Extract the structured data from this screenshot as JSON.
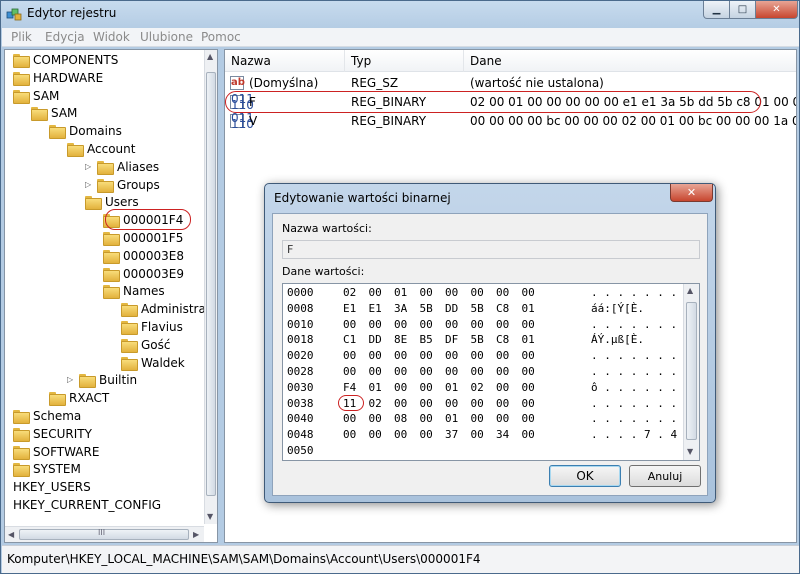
{
  "window": {
    "title": "Edytor rejestru"
  },
  "menu": [
    "Plik",
    "Edycja",
    "Widok",
    "Ulubione",
    "Pomoc"
  ],
  "tree": {
    "items": [
      {
        "label": "COMPONENTS",
        "level": 0,
        "expander": ""
      },
      {
        "label": "HARDWARE",
        "level": 0,
        "expander": ""
      },
      {
        "label": "SAM",
        "level": 0,
        "expander": ""
      },
      {
        "label": "SAM",
        "level": 1,
        "expander": ""
      },
      {
        "label": "Domains",
        "level": 2,
        "expander": ""
      },
      {
        "label": "Account",
        "level": 3,
        "expander": ""
      },
      {
        "label": "Aliases",
        "level": 4,
        "expander": "▷"
      },
      {
        "label": "Groups",
        "level": 4,
        "expander": "▷"
      },
      {
        "label": "Users",
        "level": 4,
        "expander": ""
      },
      {
        "label": "000001F4",
        "level": 5,
        "expander": ""
      },
      {
        "label": "000001F5",
        "level": 5,
        "expander": ""
      },
      {
        "label": "000003E8",
        "level": 5,
        "expander": ""
      },
      {
        "label": "000003E9",
        "level": 5,
        "expander": ""
      },
      {
        "label": "Names",
        "level": 5,
        "expander": ""
      },
      {
        "label": "Administra",
        "level": 6,
        "expander": ""
      },
      {
        "label": "Flavius",
        "level": 6,
        "expander": ""
      },
      {
        "label": "Gość",
        "level": 6,
        "expander": ""
      },
      {
        "label": "Waldek",
        "level": 6,
        "expander": ""
      },
      {
        "label": "Builtin",
        "level": 3,
        "expander": "▷"
      },
      {
        "label": "RXACT",
        "level": 2,
        "expander": ""
      },
      {
        "label": "Schema",
        "level": 0,
        "expander": ""
      },
      {
        "label": "SECURITY",
        "level": 0,
        "expander": ""
      },
      {
        "label": "SOFTWARE",
        "level": 0,
        "expander": ""
      },
      {
        "label": "SYSTEM",
        "level": 0,
        "expander": ""
      },
      {
        "label": "HKEY_USERS",
        "level": -1,
        "expander": ""
      },
      {
        "label": "HKEY_CURRENT_CONFIG",
        "level": -1,
        "expander": ""
      }
    ],
    "hscroll_grip": "III"
  },
  "list": {
    "columns": [
      "Nazwa",
      "Typ",
      "Dane"
    ],
    "rows": [
      {
        "icon": "ab",
        "name": "(Domyślna)",
        "type": "REG_SZ",
        "data": "(wartość nie ustalona)"
      },
      {
        "icon": "bin",
        "name": "F",
        "type": "REG_BINARY",
        "data": "02 00 01 00 00 00 00 00 e1 e1 3a 5b dd 5b c8 01 00 0..."
      },
      {
        "icon": "bin",
        "name": "V",
        "type": "REG_BINARY",
        "data": "00 00 00 00 bc 00 00 00 02 00 01 00 bc 00 00 00 1a 0..."
      }
    ]
  },
  "status": {
    "path": "Komputer\\HKEY_LOCAL_MACHINE\\SAM\\SAM\\Domains\\Account\\Users\\000001F4"
  },
  "dialog": {
    "title": "Edytowanie wartości binarnej",
    "name_label": "Nazwa wartości:",
    "name_value": "F",
    "data_label": "Dane wartości:",
    "hex_rows": [
      {
        "offset": "0000",
        "bytes": [
          "02",
          "00",
          "01",
          "00",
          "00",
          "00",
          "00",
          "00"
        ],
        "ascii": ". . . . . . . ."
      },
      {
        "offset": "0008",
        "bytes": [
          "E1",
          "E1",
          "3A",
          "5B",
          "DD",
          "5B",
          "C8",
          "01"
        ],
        "ascii": "áá:[Ý[È."
      },
      {
        "offset": "0010",
        "bytes": [
          "00",
          "00",
          "00",
          "00",
          "00",
          "00",
          "00",
          "00"
        ],
        "ascii": ". . . . . . . ."
      },
      {
        "offset": "0018",
        "bytes": [
          "C1",
          "DD",
          "8E",
          "B5",
          "DF",
          "5B",
          "C8",
          "01"
        ],
        "ascii": "ÁÝ.µß[È."
      },
      {
        "offset": "0020",
        "bytes": [
          "00",
          "00",
          "00",
          "00",
          "00",
          "00",
          "00",
          "00"
        ],
        "ascii": ". . . . . . . ."
      },
      {
        "offset": "0028",
        "bytes": [
          "00",
          "00",
          "00",
          "00",
          "00",
          "00",
          "00",
          "00"
        ],
        "ascii": ". . . . . . . ."
      },
      {
        "offset": "0030",
        "bytes": [
          "F4",
          "01",
          "00",
          "00",
          "01",
          "02",
          "00",
          "00"
        ],
        "ascii": "ô . . . . . . ."
      },
      {
        "offset": "0038",
        "bytes": [
          "11",
          "02",
          "00",
          "00",
          "00",
          "00",
          "00",
          "00"
        ],
        "ascii": ". . . . . . . ."
      },
      {
        "offset": "0040",
        "bytes": [
          "00",
          "00",
          "08",
          "00",
          "01",
          "00",
          "00",
          "00"
        ],
        "ascii": ". . . . . . . ."
      },
      {
        "offset": "0048",
        "bytes": [
          "00",
          "00",
          "00",
          "00",
          "37",
          "00",
          "34",
          "00"
        ],
        "ascii": ". . . . 7 . 4 ."
      },
      {
        "offset": "0050",
        "bytes": [],
        "ascii": ""
      }
    ],
    "ok_label": "OK",
    "cancel_label": "Anuluj"
  }
}
